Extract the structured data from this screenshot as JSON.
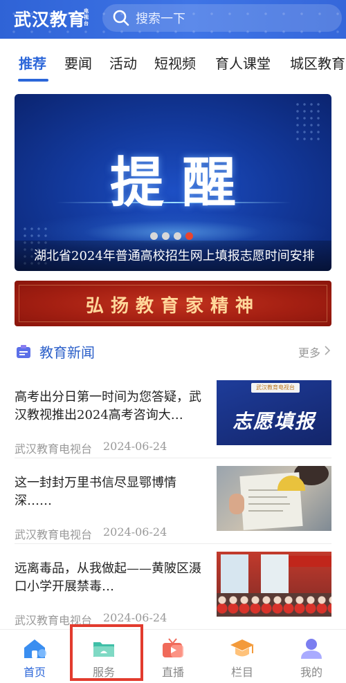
{
  "app": {
    "logo": "武汉教育",
    "logo_sub": "电视台"
  },
  "search": {
    "placeholder": "搜索一下"
  },
  "tabs": [
    {
      "label": "推荐",
      "active": true
    },
    {
      "label": "要闻"
    },
    {
      "label": "活动"
    },
    {
      "label": "短视频"
    },
    {
      "label": "育人课堂"
    },
    {
      "label": "城区教育"
    }
  ],
  "banner": {
    "title": "提醒",
    "caption": "湖北省2024年普通高校招生网上填报志愿时间安排",
    "page_count": 4,
    "active_page": 4
  },
  "spirit_banner": {
    "text": "弘扬教育家精神"
  },
  "news_section": {
    "title": "教育新闻",
    "more": "更多"
  },
  "news": [
    {
      "title": "高考出分日第一时间为您答疑，武汉教视推出2024高考咨询大…",
      "source": "武汉教育电视台",
      "date": "2024-06-24",
      "thumb_tag": "武汉教育电视台",
      "thumb_text": "志愿填报"
    },
    {
      "title": "这一封封万里书信尽显鄂博情深……",
      "source": "武汉教育电视台",
      "date": "2024-06-24"
    },
    {
      "title": "远离毒品，从我做起——黄陂区滠口小学开展禁毒…",
      "source": "武汉教育电视台",
      "date": "2024-06-24"
    }
  ],
  "bottom_nav": [
    {
      "label": "首页",
      "icon": "home-icon",
      "active": true,
      "color": "#3a8ef0"
    },
    {
      "label": "服务",
      "icon": "service-icon",
      "color": "#3fbfa7"
    },
    {
      "label": "直播",
      "icon": "live-tv-icon",
      "color": "#f06a5a"
    },
    {
      "label": "栏目",
      "icon": "column-icon",
      "color": "#f39a3a"
    },
    {
      "label": "我的",
      "icon": "profile-icon",
      "color": "#7b7ef0"
    }
  ],
  "colors": {
    "accent": "#2b66d9",
    "highlight": "#e23b2e"
  }
}
